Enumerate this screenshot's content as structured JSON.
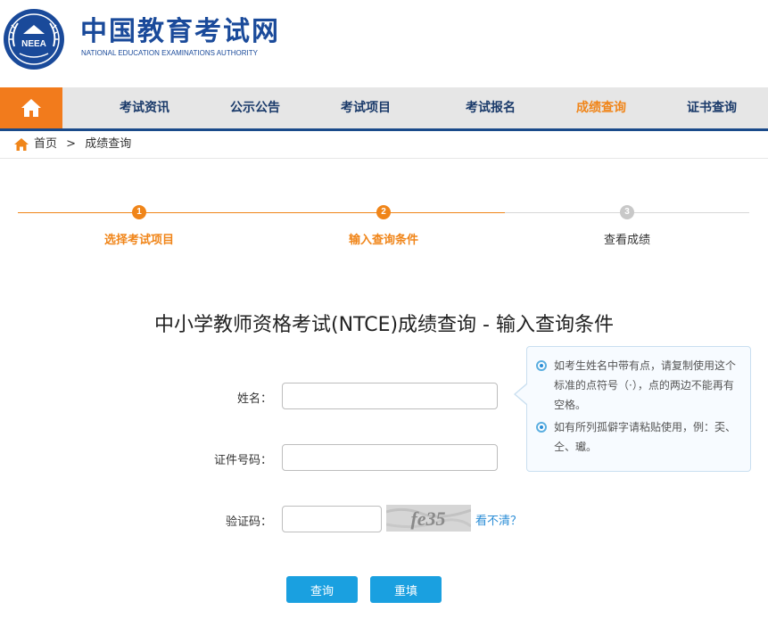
{
  "header": {
    "emblem_text": "NEEA",
    "title": "中国教育考试网",
    "subtitle": "NATIONAL EDUCATION EXAMINATIONS AUTHORITY"
  },
  "nav": {
    "items": [
      {
        "label": "考试资讯"
      },
      {
        "label": "公示公告"
      },
      {
        "label": "考试项目"
      },
      {
        "label": "考试报名"
      },
      {
        "label": "成绩查询"
      },
      {
        "label": "证书查询"
      }
    ],
    "active_index": 4
  },
  "breadcrumb": {
    "home": "首页",
    "separator": ">",
    "current": "成绩查询"
  },
  "steps": [
    {
      "number": "1",
      "label": "选择考试项目",
      "state": "done"
    },
    {
      "number": "2",
      "label": "输入查询条件",
      "state": "done"
    },
    {
      "number": "3",
      "label": "查看成绩",
      "state": "todo"
    }
  ],
  "form": {
    "title": "中小学教师资格考试(NTCE)成绩查询 - 输入查询条件",
    "name_label": "姓名：",
    "name_value": "",
    "id_label": "证件号码：",
    "id_value": "",
    "captcha_label": "验证码：",
    "captcha_value": "",
    "captcha_text": "fe35",
    "refresh_label": "看不清？",
    "submit_label": "查询",
    "reset_label": "重填"
  },
  "tips": [
    "如考生姓名中带有点，请复制使用这个标准的点符号（·），点的两边不能再有空格。",
    "如有所列孤僻字请粘贴使用，例：奀、仝、瓛。"
  ],
  "colors": {
    "brand_blue": "#1a4a9a",
    "accent_orange": "#f08519",
    "button_blue": "#1aa0e0",
    "link_blue": "#2b8dd6"
  }
}
